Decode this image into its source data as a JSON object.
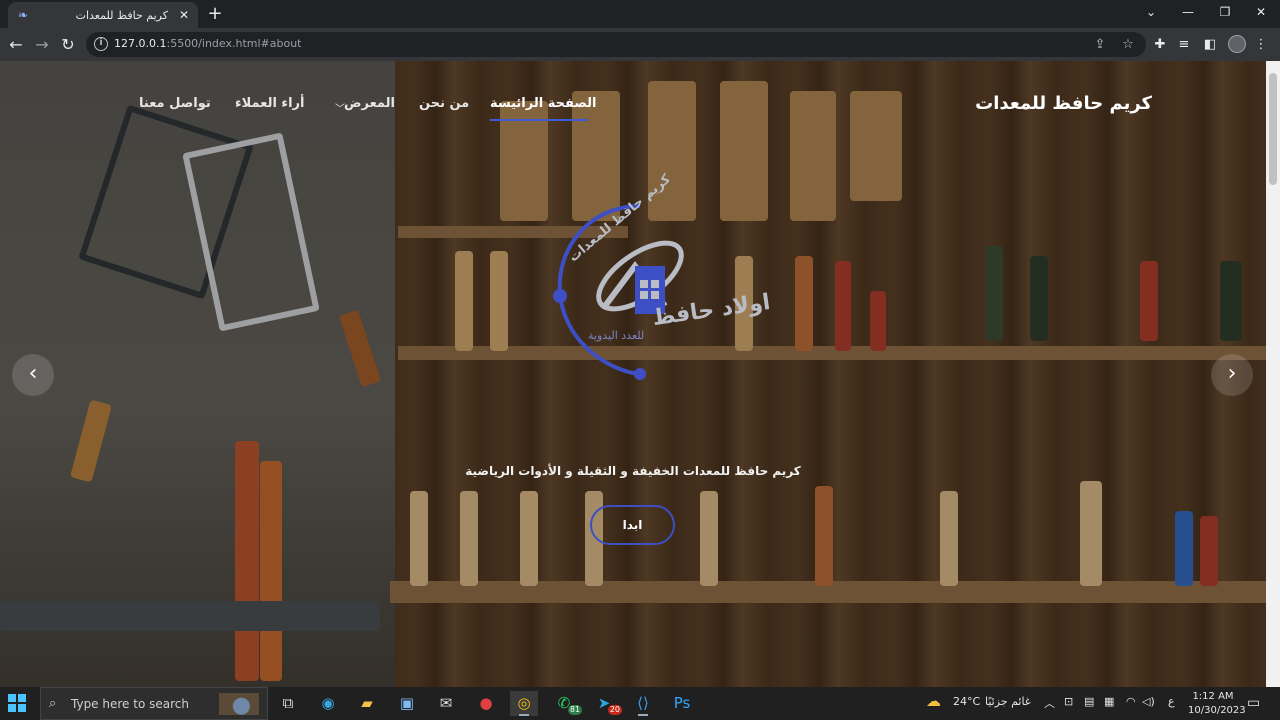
{
  "browser": {
    "tab_title": "كريم حافظ للمعدات",
    "url_host": "127.0.0.1",
    "url_path": ":5500/index.html#about"
  },
  "site": {
    "brand": "كريم حافظ للمعدات",
    "nav": {
      "home": "الصفحة الرائيسة",
      "about": "من نحن",
      "gallery": "المعرض",
      "reviews": "أراء العملاء",
      "contact": "تواصل معنا"
    },
    "logo": {
      "main_text": "اولاد حافظ",
      "sub_text": "للعدد اليدوية",
      "arc_text": "كريم حافظ للمعدات"
    },
    "hero": {
      "tagline": "كريم حافظ للمعدات الخفيفة و الثقيلة و الأدوات الرياضية",
      "cta": "ابدا"
    },
    "colors": {
      "accent": "#3d4fc4",
      "underline": "#3d5bd9"
    }
  },
  "taskbar": {
    "search_placeholder": "Type here to search",
    "whatsapp_badge": "81",
    "telegram_badge": "20",
    "weather_temp": "24°C",
    "weather_text": "غائم جزئيًا",
    "lang": "ع",
    "time": "1:12 AM",
    "date": "10/30/2023"
  }
}
